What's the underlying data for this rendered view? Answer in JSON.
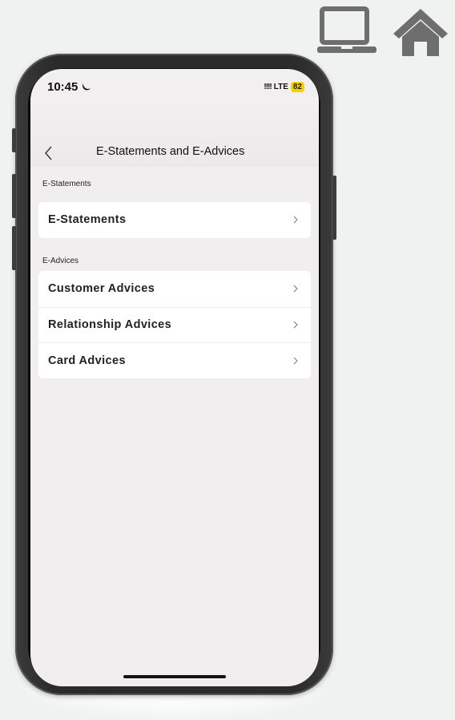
{
  "status_bar": {
    "time": "10:45",
    "signal": "!!!!",
    "network": "LTE",
    "battery": "82"
  },
  "header": {
    "title": "E-Statements and E-Advices"
  },
  "sections": [
    {
      "label": "E-Statements",
      "items": [
        {
          "label": "E-Statements"
        }
      ]
    },
    {
      "label": "E-Advices",
      "items": [
        {
          "label": "Customer Advices"
        },
        {
          "label": "Relationship Advices"
        },
        {
          "label": "Card Advices"
        }
      ]
    }
  ],
  "icons": {
    "desktop": "laptop-icon",
    "home": "home-icon",
    "back": "chevron-left-icon",
    "row_arrow": "chevron-right-icon"
  },
  "colors": {
    "battery": "#f5d100",
    "page_background": "#f0eeef",
    "card_background": "#ffffff",
    "top_icon": "#6e6e6e"
  }
}
